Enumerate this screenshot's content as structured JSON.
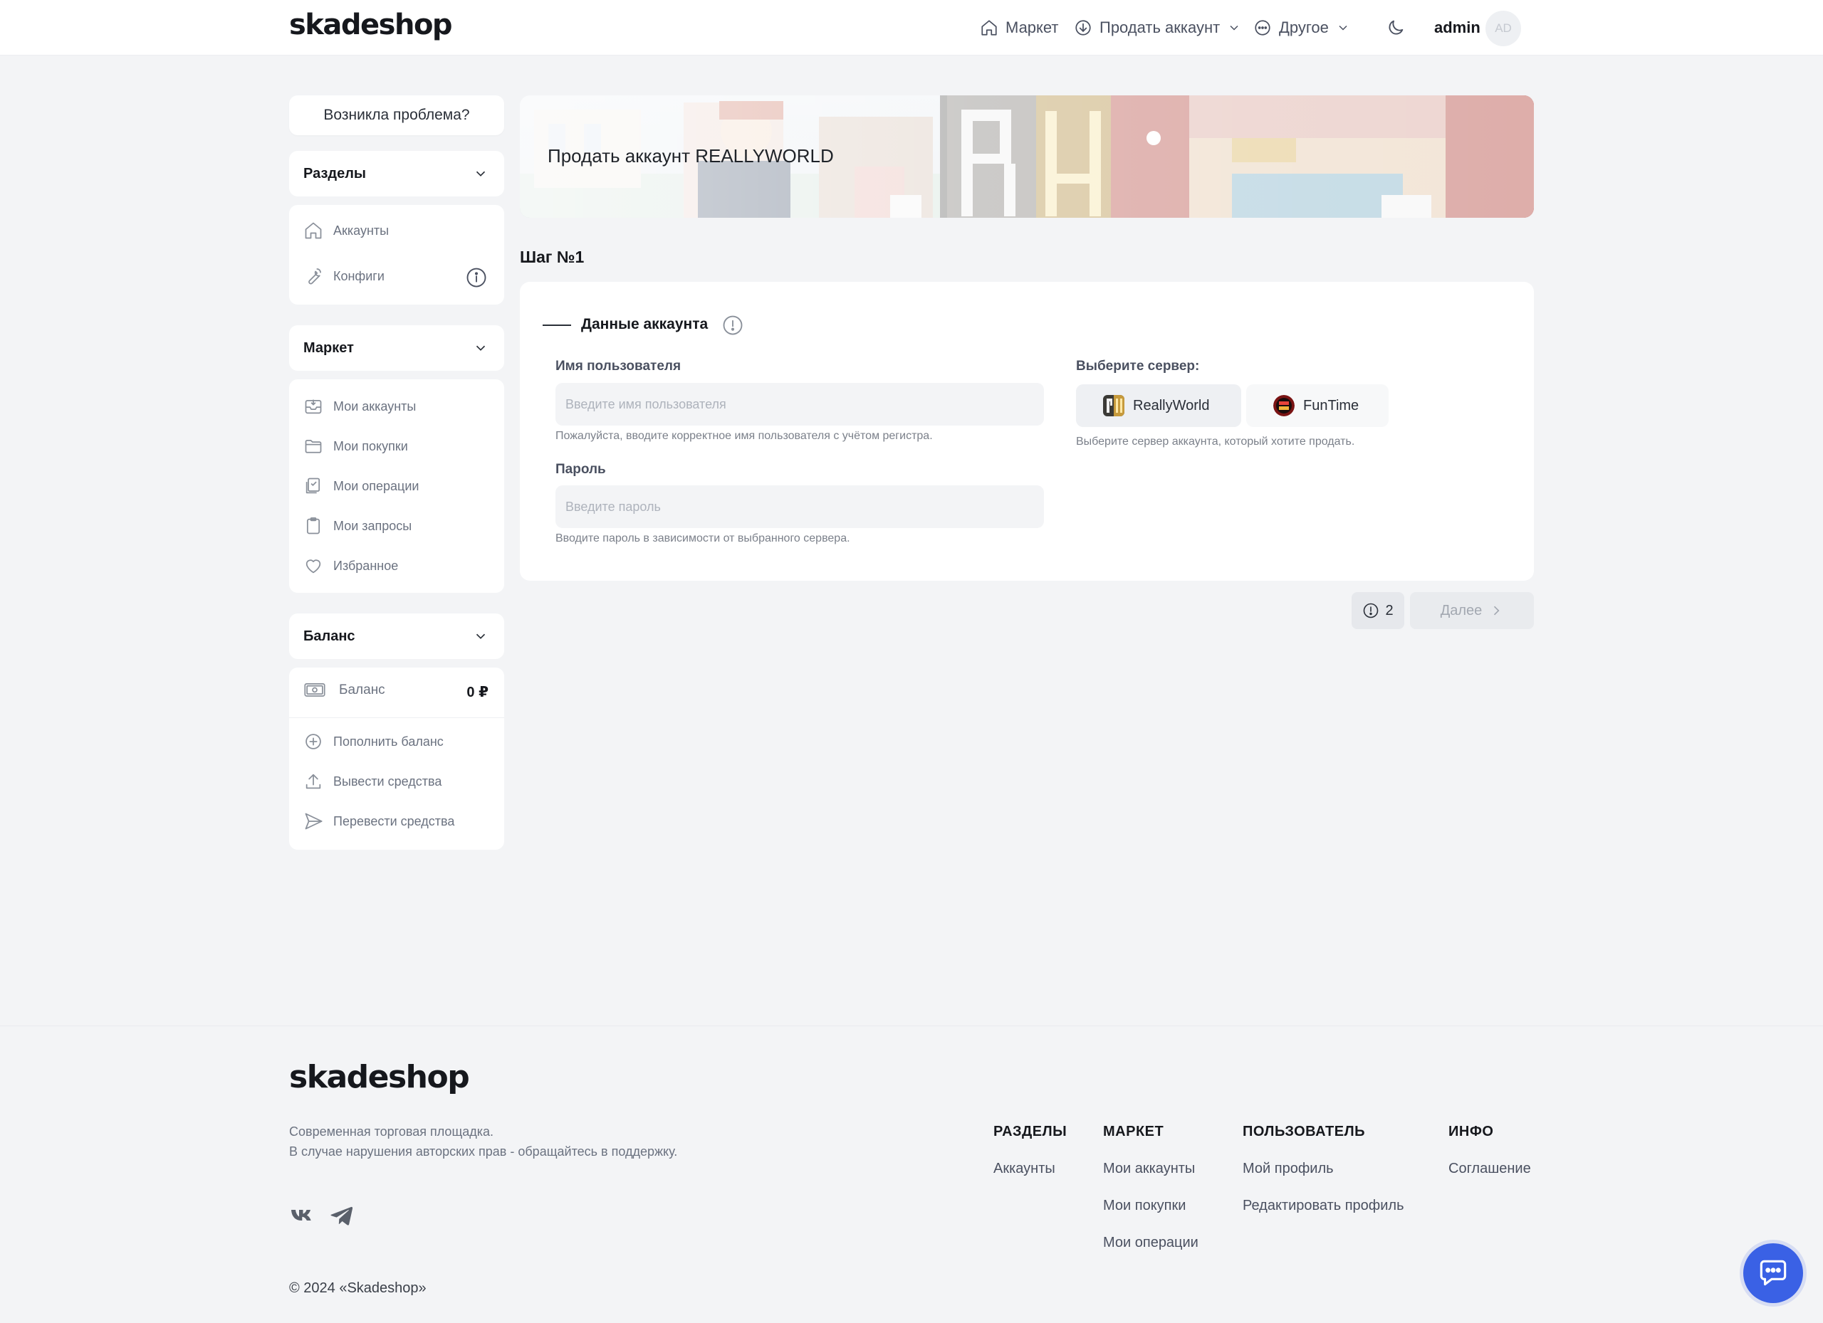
{
  "header": {
    "logo": "skadeshop",
    "nav": {
      "market": "Маркет",
      "sell_account": "Продать аккаунт",
      "other": "Другое"
    },
    "username": "admin",
    "avatar_initials": "AD"
  },
  "sidebar": {
    "problem_button": "Возникла проблема?",
    "sections": {
      "title": "Разделы",
      "items": [
        {
          "label": "Аккаунты",
          "icon": "home-icon"
        },
        {
          "label": "Конфиги",
          "icon": "wrench-icon"
        }
      ]
    },
    "market": {
      "title": "Маркет",
      "items": [
        {
          "label": "Мои аккаунты",
          "icon": "inbox-icon"
        },
        {
          "label": "Мои покупки",
          "icon": "folder-icon"
        },
        {
          "label": "Мои операции",
          "icon": "operations-icon"
        },
        {
          "label": "Мои запросы",
          "icon": "clipboard-icon"
        },
        {
          "label": "Избранное",
          "icon": "heart-icon"
        }
      ]
    },
    "balance": {
      "title": "Баланс",
      "balance_label": "Баланс",
      "balance_value": "0 ₽",
      "items": [
        {
          "label": "Пополнить баланс",
          "icon": "plus-circle-icon"
        },
        {
          "label": "Вывести средства",
          "icon": "upload-icon"
        },
        {
          "label": "Перевести средства",
          "icon": "send-icon"
        }
      ]
    }
  },
  "banner": {
    "title": "Продать аккаунт REALLYWORLD"
  },
  "step": {
    "title": "Шаг №1",
    "section_title": "Данные аккаунта",
    "username": {
      "label": "Имя пользователя",
      "placeholder": "Введите имя пользователя",
      "value": "",
      "hint": "Пожалуйста, вводите корректное имя пользователя с учётом регистра."
    },
    "password": {
      "label": "Пароль",
      "placeholder": "Введите пароль",
      "value": "",
      "hint": "Вводите пароль в зависимости от выбранного сервера."
    },
    "server": {
      "label": "Выберите сервер:",
      "options": [
        "ReallyWorld",
        "FunTime"
      ],
      "selected": "ReallyWorld",
      "hint": "Выберите сервер аккаунта, который хотите продать."
    },
    "errors_count": "2",
    "next_label": "Далее"
  },
  "footer": {
    "logo": "skadeshop",
    "desc_line1": "Современная торговая площадка.",
    "desc_line2": "В случае нарушения авторских прав - обращайтесь в поддержку.",
    "copyright": "© 2024 «Skadeshop»",
    "columns": [
      {
        "title": "РАЗДЕЛЫ",
        "links": [
          "Аккаунты"
        ]
      },
      {
        "title": "МАРКЕТ",
        "links": [
          "Мои аккаунты",
          "Мои покупки",
          "Мои операции"
        ]
      },
      {
        "title": "ПОЛЬЗОВАТЕЛЬ",
        "links": [
          "Мой профиль",
          "Редактировать профиль"
        ]
      },
      {
        "title": "ИНФО",
        "links": [
          "Соглашение"
        ]
      }
    ]
  },
  "colors": {
    "accent": "#3a61e5",
    "page_bg": "#f3f4f6",
    "card_bg": "#ffffff"
  }
}
